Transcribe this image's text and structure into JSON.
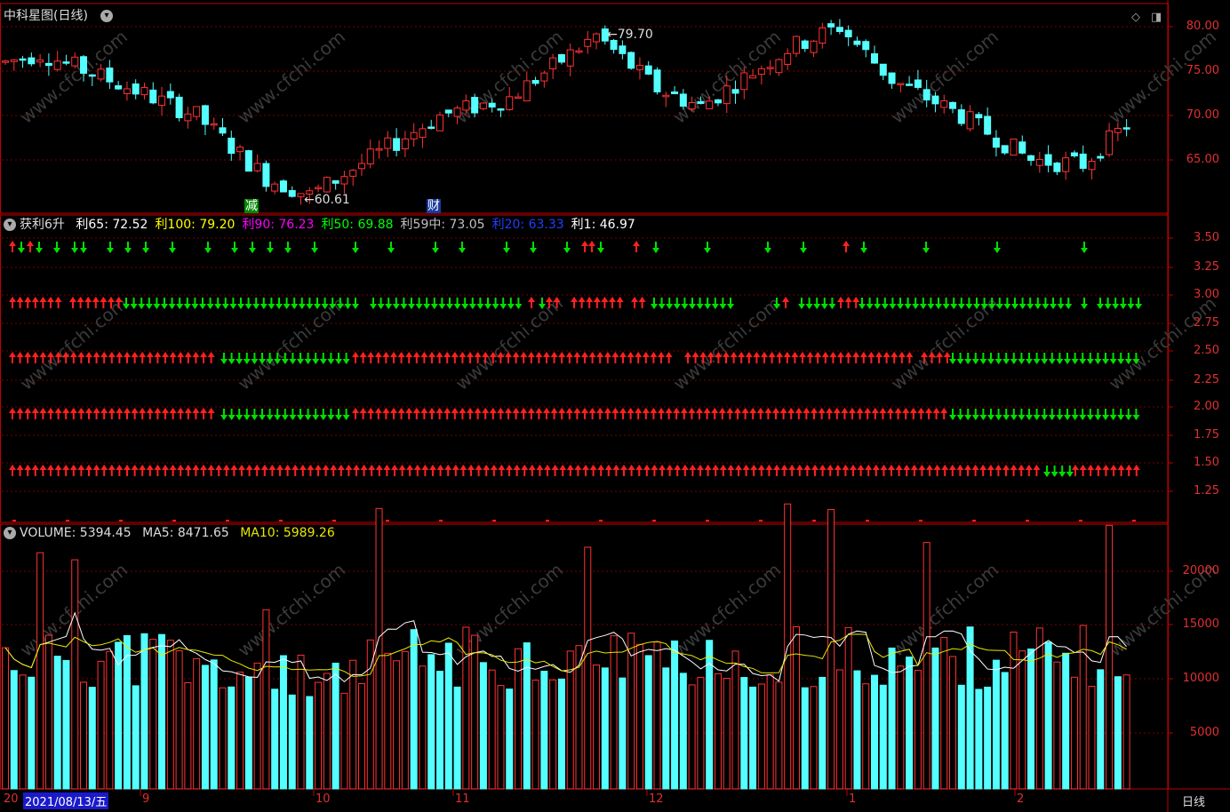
{
  "title": "中科星图(日线)",
  "colors": {
    "up": "#ff3232",
    "down": "#54ffff",
    "grid": "#7a0000",
    "axis": "#c00000",
    "green_arrow": "#00e000",
    "red_arrow": "#ff2020"
  },
  "price_panel": {
    "ticks": [
      "80.00",
      "75.00",
      "70.00",
      "65.00"
    ],
    "high_label": "79.70",
    "low_label": "60.61",
    "tag_jian": "减",
    "tag_cai": "财"
  },
  "indicator_panel": {
    "name": "获利6升",
    "items": [
      {
        "label": "利65: 72.52",
        "color": "#ffffff"
      },
      {
        "label": "利100: 79.20",
        "color": "#ffff00"
      },
      {
        "label": "利90: 76.23",
        "color": "#ff00ff"
      },
      {
        "label": "利50: 69.88",
        "color": "#00ff00"
      },
      {
        "label": "利59中: 73.05",
        "color": "#c0c0c0"
      },
      {
        "label": "利20: 63.33",
        "color": "#1f3fff"
      },
      {
        "label": "利1: 46.97",
        "color": "#ffffff"
      }
    ],
    "ticks": [
      "3.50",
      "3.25",
      "3.00",
      "2.75",
      "2.50",
      "2.25",
      "2.00",
      "1.75",
      "1.50",
      "1.25"
    ]
  },
  "volume_panel": {
    "label_volume": "VOLUME: 5394.45",
    "label_ma5": "MA5: 8471.65",
    "label_ma10": "MA10: 5989.26",
    "ticks": [
      "20000",
      "15000",
      "10000",
      "5000"
    ]
  },
  "date_axis": {
    "left_label": "20",
    "cursor_date": "2021/08/13/五",
    "months": [
      {
        "label": "9",
        "pos": "9"
      },
      {
        "label": "10",
        "pos": "10"
      },
      {
        "label": "11",
        "pos": "11"
      },
      {
        "label": "12",
        "pos": "12"
      },
      {
        "label": "1",
        "pos": "1"
      },
      {
        "label": "2",
        "pos": "2"
      }
    ],
    "period": "日线"
  },
  "watermark": "www.cfchi.com"
}
